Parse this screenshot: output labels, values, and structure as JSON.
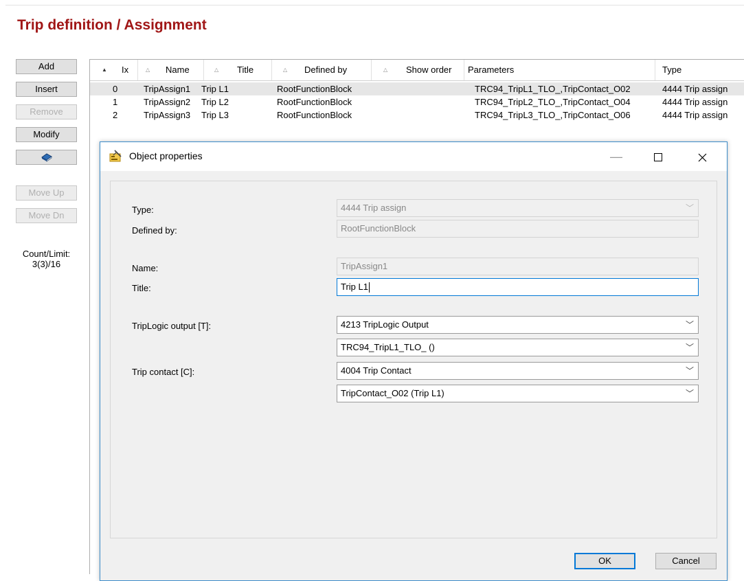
{
  "page": {
    "title": "Trip definition / Assignment"
  },
  "sidebar": {
    "add": "Add",
    "insert": "Insert",
    "remove": "Remove",
    "modify": "Modify",
    "move_up": "Move Up",
    "move_dn": "Move Dn",
    "count_label": "Count/Limit:",
    "count_value": "3(3)/16"
  },
  "grid": {
    "columns": [
      "Ix",
      "Name",
      "Title",
      "Defined by",
      "Show order",
      "Parameters",
      "Type"
    ],
    "rows": [
      {
        "ix": "0",
        "name": "TripAssign1",
        "title": "Trip L1",
        "defined_by": "RootFunctionBlock",
        "show_order": "",
        "parameters": "TRC94_TripL1_TLO_,TripContact_O02",
        "type": "4444 Trip assign"
      },
      {
        "ix": "1",
        "name": "TripAssign2",
        "title": "Trip L2",
        "defined_by": "RootFunctionBlock",
        "show_order": "",
        "parameters": "TRC94_TripL2_TLO_,TripContact_O04",
        "type": "4444 Trip assign"
      },
      {
        "ix": "2",
        "name": "TripAssign3",
        "title": "Trip L3",
        "defined_by": "RootFunctionBlock",
        "show_order": "",
        "parameters": "TRC94_TripL3_TLO_,TripContact_O06",
        "type": "4444 Trip assign"
      }
    ]
  },
  "dialog": {
    "title": "Object properties",
    "labels": {
      "type": "Type:",
      "defined_by": "Defined by:",
      "name": "Name:",
      "title": "Title:",
      "trip_logic_output": "TripLogic output [T]:",
      "trip_contact": "Trip contact [C]:"
    },
    "values": {
      "type": "4444  Trip assign",
      "defined_by": "RootFunctionBlock",
      "name": "TripAssign1",
      "title": "Trip L1",
      "trip_logic_type": "4213  TripLogic Output",
      "trip_logic_object": "TRC94_TripL1_TLO_ ()",
      "trip_contact_type": "4004  Trip Contact",
      "trip_contact_object": "TripContact_O02 (Trip L1)"
    },
    "ok": "OK",
    "cancel": "Cancel"
  },
  "icons": {
    "dialog_icon": "object-properties-icon",
    "book": "book-icon",
    "sort": "sort-arrow-icon",
    "chevron": "chevron-down-icon"
  },
  "colors": {
    "title_red": "#a01616",
    "accent_blue": "#0078d7",
    "selected_row": "#e6e6e6"
  }
}
